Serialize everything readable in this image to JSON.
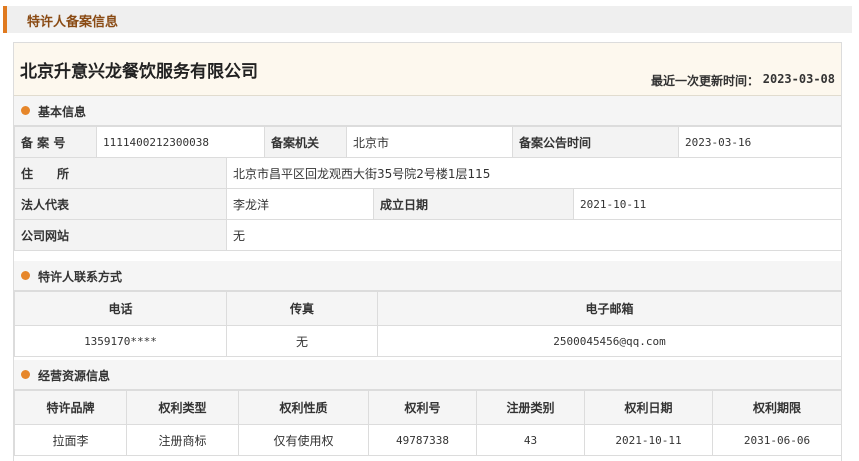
{
  "section_title": "特许人备案信息",
  "company": {
    "name": "北京升意兴龙餐饮服务有限公司",
    "update_label": "最近一次更新时间：",
    "update_date": "2023-03-08"
  },
  "basic": {
    "title": "基本信息",
    "record_no_label": "备 案 号",
    "record_no": "1111400212300038",
    "authority_label": "备案机关",
    "authority": "北京市",
    "announce_label": "备案公告时间",
    "announce_date": "2023-03-16",
    "address_label": "住　　所",
    "address": "北京市昌平区回龙观西大街35号院2号楼1层115",
    "legal_label": "法人代表",
    "legal": "李龙洋",
    "founded_label": "成立日期",
    "founded": "2021-10-11",
    "website_label": "公司网站",
    "website": "无"
  },
  "contact": {
    "title": "特许人联系方式",
    "headers": [
      "电话",
      "传真",
      "电子邮箱"
    ],
    "phone": "1359170****",
    "fax": "无",
    "email": "2500045456@qq.com"
  },
  "resources": {
    "title": "经营资源信息",
    "headers": [
      "特许品牌",
      "权利类型",
      "权利性质",
      "权利号",
      "注册类别",
      "权利日期",
      "权利期限"
    ],
    "rows": [
      [
        "拉面李",
        "注册商标",
        "仅有使用权",
        "49787338",
        "43",
        "2021-10-11",
        "2031-06-06"
      ]
    ]
  },
  "colors": {
    "accent": "#e07a1f",
    "dot": "#e6862a"
  }
}
